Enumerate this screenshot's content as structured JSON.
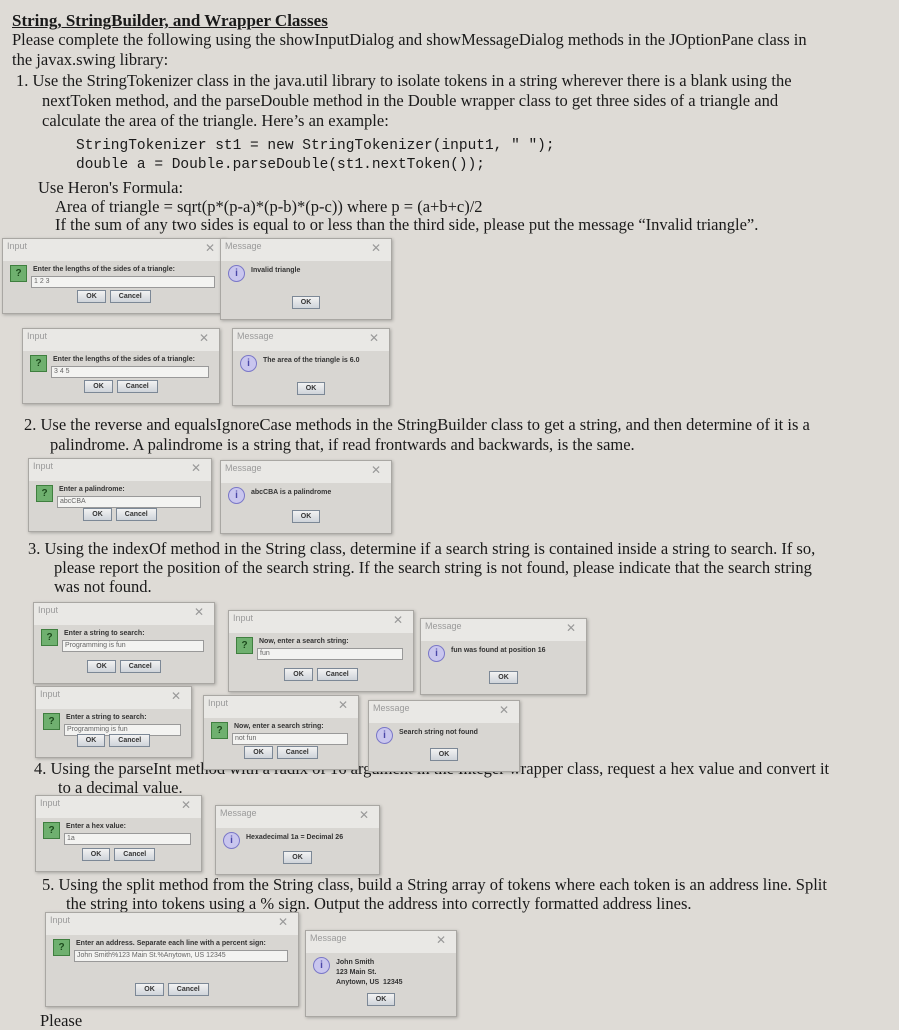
{
  "title": "String, StringBuilder, and Wrapper Classes",
  "lines": [
    "Please complete the following using the showInputDialog and showMessageDialog methods in the JOptionPane class in",
    "the javax.swing library:",
    "1.  Use the StringTokenizer class in the java.util library to isolate tokens in a string wherever there is a blank using the",
    "nextToken method, and the parseDouble method in the Double wrapper class to get three sides of a triangle and",
    "calculate the area of the triangle.  Here’s an example:",
    "StringTokenizer st1 = new StringTokenizer(input1, \" \");",
    "double a = Double.parseDouble(st1.nextToken());",
    "Use Heron's Formula:",
    "Area of triangle = sqrt(p*(p-a)*(p-b)*(p-c))     where p = (a+b+c)/2",
    "If the sum of any two sides is equal to or less than the third side, please put the message “Invalid triangle”.",
    "2.  Use the reverse and equalsIgnoreCase methods in the StringBuilder class to get a string, and then determine of it is a",
    "palindrome.  A palindrome is a string that, if read frontwards and backwards, is the same.",
    "3.  Using the indexOf method in the String class, determine if a search string is contained inside a string to search.  If so,",
    "please report the position of the search string.  If the search string is not found, please indicate that the search string",
    "was not found.",
    "4.  Using the parseInt method with a radix of 16 argument in the Integer wrapper class, request a hex value and convert it",
    "to a decimal value.",
    "5.  Using the split method from the String class, build a String array of tokens where each token is an address line.  Split",
    "the string into tokens using a % sign.  Output the address into correctly formatted address lines.",
    "Please"
  ],
  "dialogs": [
    {
      "type": "input",
      "title": "Input",
      "prompt": "Enter the lengths of the sides of a triangle:",
      "value": "1 2 3",
      "ok": "OK",
      "cancel": "Cancel"
    },
    {
      "type": "message",
      "title": "Message",
      "text": "Invalid triangle",
      "ok": "OK"
    },
    {
      "type": "input",
      "title": "Input",
      "prompt": "Enter the lengths of the sides of a triangle:",
      "value": "3 4 5",
      "ok": "OK",
      "cancel": "Cancel"
    },
    {
      "type": "message",
      "title": "Message",
      "text": "The area of the triangle is 6.0",
      "ok": "OK"
    },
    {
      "type": "input",
      "title": "Input",
      "prompt": "Enter a palindrome:",
      "value": "abcCBA",
      "ok": "OK",
      "cancel": "Cancel"
    },
    {
      "type": "message",
      "title": "Message",
      "text": "abcCBA is a palindrome",
      "ok": "OK"
    },
    {
      "type": "input",
      "title": "Input",
      "prompt": "Enter a string to search:",
      "value": "Programming is fun",
      "ok": "OK",
      "cancel": "Cancel"
    },
    {
      "type": "input",
      "title": "Input",
      "prompt": "Now, enter a search string:",
      "value": "fun",
      "ok": "OK",
      "cancel": "Cancel"
    },
    {
      "type": "message",
      "title": "Message",
      "text": "fun was found at position 16",
      "ok": "OK"
    },
    {
      "type": "input",
      "title": "Input",
      "prompt": "Enter a string to search:",
      "value": "Programming is fun",
      "ok": "OK",
      "cancel": "Cancel"
    },
    {
      "type": "input",
      "title": "Input",
      "prompt": "Now, enter a search string:",
      "value": "not fun",
      "ok": "OK",
      "cancel": "Cancel"
    },
    {
      "type": "message",
      "title": "Message",
      "text": "Search string not found",
      "ok": "OK"
    },
    {
      "type": "input",
      "title": "Input",
      "prompt": "Enter a hex value:",
      "value": "1a",
      "ok": "OK",
      "cancel": "Cancel"
    },
    {
      "type": "message",
      "title": "Message",
      "text": "Hexadecimal 1a = Decimal 26",
      "ok": "OK"
    },
    {
      "type": "input",
      "title": "Input",
      "prompt": "Enter an address.  Separate each line with a percent sign:",
      "value": "John Smith%123 Main St.%Anytown, US  12345",
      "ok": "OK",
      "cancel": "Cancel"
    },
    {
      "type": "message",
      "title": "Message",
      "text": "John Smith\n123 Main St.\nAnytown, US  12345",
      "ok": "OK"
    }
  ]
}
